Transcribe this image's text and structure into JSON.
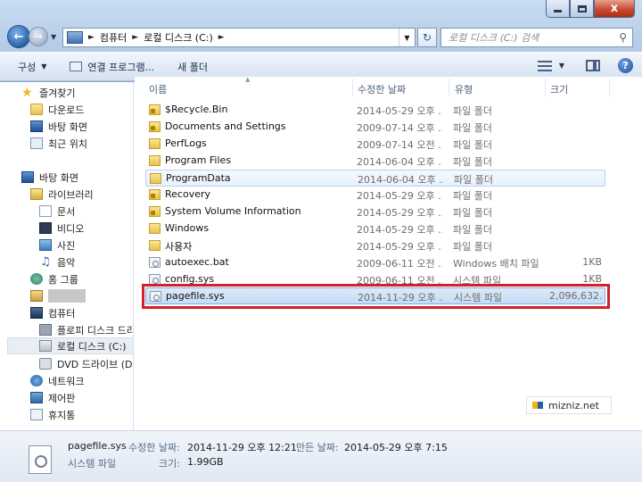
{
  "window": {
    "caption_buttons": {
      "minimize": "minimize",
      "maximize": "maximize",
      "close": "x"
    }
  },
  "address_bar": {
    "breadcrumbs": [
      "컴퓨터",
      "로컬 디스크 (C:)"
    ],
    "search_placeholder": "로컬 디스크 (C:) 검색"
  },
  "command_bar": {
    "organize": "구성",
    "open_with": "연결 프로그램...",
    "new_folder": "새 폴더",
    "help": "?"
  },
  "nav_pane": {
    "favorites": "즐겨찾기",
    "downloads": "다운로드",
    "desktop_fav": "바탕 화면",
    "recent": "최근 위치",
    "desktop": "바탕 화면",
    "libraries": "라이브러리",
    "documents": "문서",
    "videos": "비디오",
    "pictures": "사진",
    "music": "음악",
    "homegroup": "홈 그룹",
    "computer": "컴퓨터",
    "floppy": "플로피 디스크 드라이브",
    "local_disk": "로컬 디스크 (C:)",
    "dvd": "DVD 드라이브 (D:)",
    "network": "네트워크",
    "control_panel": "제어판",
    "recycle_bin": "휴지통"
  },
  "columns": {
    "name": "이름",
    "date": "수정한 날짜",
    "type": "유형",
    "size": "크기"
  },
  "files": [
    {
      "name": "$Recycle.Bin",
      "date": "2014-05-29 오후 ...",
      "type": "파일 폴더",
      "size": "",
      "icon": "locked-folder-icon"
    },
    {
      "name": "Documents and Settings",
      "date": "2009-07-14 오후 ...",
      "type": "파일 폴더",
      "size": "",
      "icon": "locked-folder-icon"
    },
    {
      "name": "PerfLogs",
      "date": "2009-07-14 오전 ...",
      "type": "파일 폴더",
      "size": "",
      "icon": "folder-icon"
    },
    {
      "name": "Program Files",
      "date": "2014-06-04 오후 ...",
      "type": "파일 폴더",
      "size": "",
      "icon": "folder-icon"
    },
    {
      "name": "ProgramData",
      "date": "2014-06-04 오후 ...",
      "type": "파일 폴더",
      "size": "",
      "icon": "folder-icon"
    },
    {
      "name": "Recovery",
      "date": "2014-05-29 오후 ...",
      "type": "파일 폴더",
      "size": "",
      "icon": "locked-folder-icon"
    },
    {
      "name": "System Volume Information",
      "date": "2014-05-29 오후 ...",
      "type": "파일 폴더",
      "size": "",
      "icon": "locked-folder-icon"
    },
    {
      "name": "Windows",
      "date": "2014-05-29 오후 ...",
      "type": "파일 폴더",
      "size": "",
      "icon": "folder-icon"
    },
    {
      "name": "사용자",
      "date": "2014-05-29 오후 ...",
      "type": "파일 폴더",
      "size": "",
      "icon": "folder-icon"
    },
    {
      "name": "autoexec.bat",
      "date": "2009-06-11 오전 ...",
      "type": "Windows 배치 파일",
      "size": "1KB",
      "icon": "batch-file-icon"
    },
    {
      "name": "config.sys",
      "date": "2009-06-11 오전 ...",
      "type": "시스템 파일",
      "size": "1KB",
      "icon": "system-file-icon"
    },
    {
      "name": "pagefile.sys",
      "date": "2014-11-29 오후 ...",
      "type": "시스템 파일",
      "size": "2,096,632...",
      "icon": "system-file-icon"
    }
  ],
  "watermark": "mizniz.net",
  "details": {
    "filename": "pagefile.sys",
    "modified_label": "수정한 날짜:",
    "modified_value": "2014-11-29 오후 12:21",
    "created_label": "만든 날짜:",
    "created_value": "2014-05-29 오후 7:15",
    "type": "시스템 파일",
    "size_label": "크기:",
    "size_value": "1.99GB"
  }
}
